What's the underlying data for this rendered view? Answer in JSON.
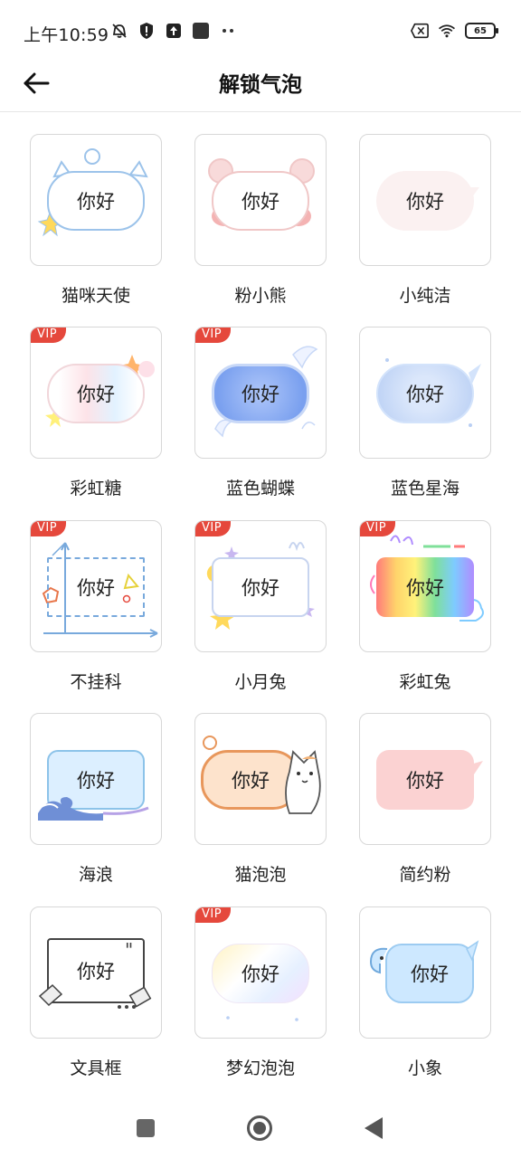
{
  "status": {
    "time": "上午10:59",
    "battery": "65",
    "icons_left": [
      "mute-icon",
      "shield-alert-icon",
      "upload-icon",
      "app-square-icon",
      "more-dots-icon"
    ],
    "icons_right": [
      "sim-blocked-icon",
      "wifi-icon",
      "battery-icon"
    ]
  },
  "header": {
    "title": "解锁气泡"
  },
  "items": [
    {
      "label": "猫咪天使",
      "bubble_text": "你好",
      "vip": "",
      "style": "b1"
    },
    {
      "label": "粉小熊",
      "bubble_text": "你好",
      "vip": "",
      "style": "b2"
    },
    {
      "label": "小纯洁",
      "bubble_text": "你好",
      "vip": "",
      "style": "b3"
    },
    {
      "label": "彩虹糖",
      "bubble_text": "你好",
      "vip": "VIP",
      "style": "b4"
    },
    {
      "label": "蓝色蝴蝶",
      "bubble_text": "你好",
      "vip": "VIP",
      "style": "b5"
    },
    {
      "label": "蓝色星海",
      "bubble_text": "你好",
      "vip": "",
      "style": "b6"
    },
    {
      "label": "不挂科",
      "bubble_text": "你好",
      "vip": "VIP",
      "style": "b7"
    },
    {
      "label": "小月兔",
      "bubble_text": "你好",
      "vip": "VIP",
      "style": "b8"
    },
    {
      "label": "彩虹兔",
      "bubble_text": "你好",
      "vip": "VIP",
      "style": "b9"
    },
    {
      "label": "海浪",
      "bubble_text": "你好",
      "vip": "",
      "style": "b10"
    },
    {
      "label": "猫泡泡",
      "bubble_text": "你好",
      "vip": "",
      "style": "b11"
    },
    {
      "label": "简约粉",
      "bubble_text": "你好",
      "vip": "",
      "style": "b12"
    },
    {
      "label": "文具框",
      "bubble_text": "你好",
      "vip": "",
      "style": "b13"
    },
    {
      "label": "梦幻泡泡",
      "bubble_text": "你好",
      "vip": "VIP",
      "style": "b14"
    },
    {
      "label": "小象",
      "bubble_text": "你好",
      "vip": "",
      "style": "b15"
    }
  ],
  "navbar": {
    "icons": [
      "recents-square-icon",
      "home-circle-icon",
      "back-triangle-icon"
    ]
  }
}
